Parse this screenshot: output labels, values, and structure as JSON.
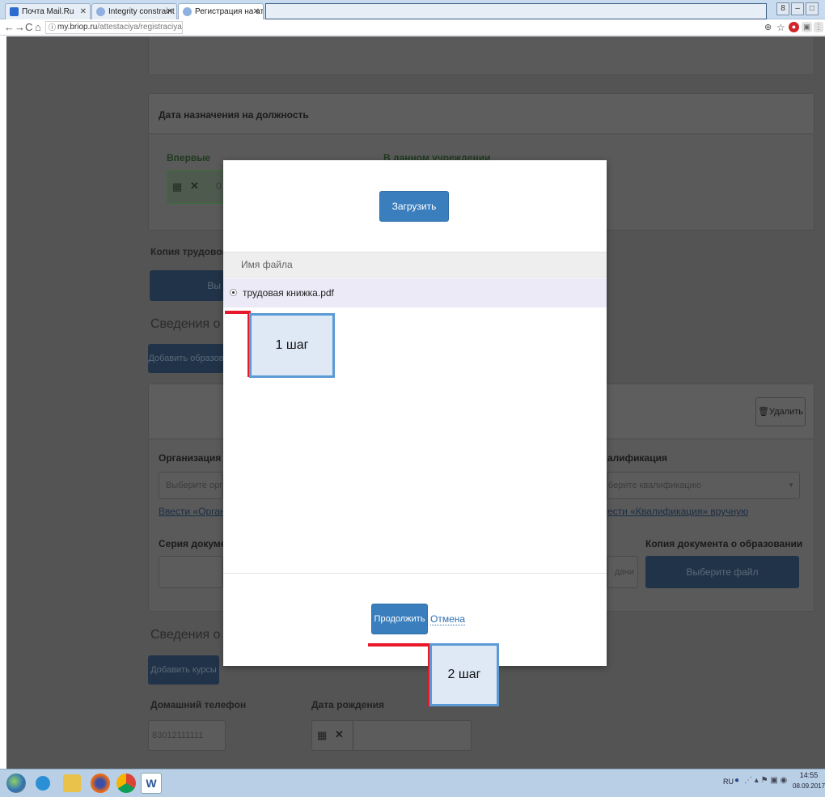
{
  "browser": {
    "tabs": [
      {
        "label": "Почта Mail.Ru",
        "favicon_color": "#2e6bd0"
      },
      {
        "label": "Integrity constraint viola",
        "favicon_color": "#8fb0e0"
      },
      {
        "label": "Регистрация на аттеста",
        "favicon_color": "#8fb0e0"
      }
    ],
    "url_host": "my.briop.ru",
    "url_path": "/attestaciya/registraciya/"
  },
  "page": {
    "position_date_title": "Дата назначения на должность",
    "first_time_label": "Впервые",
    "first_time_value": "0",
    "in_institution_label": "В данном учреждении",
    "labor_book_label": "Копия трудовой кни",
    "labor_book_button": "Вы",
    "higher_edu_heading": "Сведения о высш",
    "add_education_button": "Добавить образов",
    "delete_button": "Удалить",
    "organization_label": "Организация",
    "organization_placeholder": "Выберите органи",
    "enter_org_link": "Ввести «Организаци",
    "qualification_label": "алификация",
    "qualification_placeholder": "берите квалификацию",
    "enter_qual_link": "ести «Квалификация» вручную",
    "doc_series_label": "Серия документа",
    "doc_date_tail": "дачи",
    "edu_copy_label": "Копия документа о образовании",
    "choose_file_button": "Выберите файл",
    "courses_heading": "Сведения о курс",
    "add_courses_button": "Добавить курсы",
    "home_phone_label": "Домашний телефон",
    "home_phone_value": "83012111111",
    "birth_date_label": "Дата рождения"
  },
  "modal": {
    "upload_button": "Загрузить файл",
    "column_header": "Имя файла",
    "files": [
      {
        "name": "трудовая книжка.pdf",
        "selected": true
      }
    ],
    "continue_button": "Продолжить",
    "cancel_link": "Отмена"
  },
  "annotations": {
    "step1": "1 шаг",
    "step2": "2 шаг"
  },
  "taskbar": {
    "lang": "RU",
    "time": "14:55",
    "date": "08.09.2017"
  },
  "colors": {
    "primary": "#3a7ebd",
    "overlay_bg": "#545454",
    "callout_border": "#5b9bd5",
    "annotation_red": "#e8182b"
  }
}
